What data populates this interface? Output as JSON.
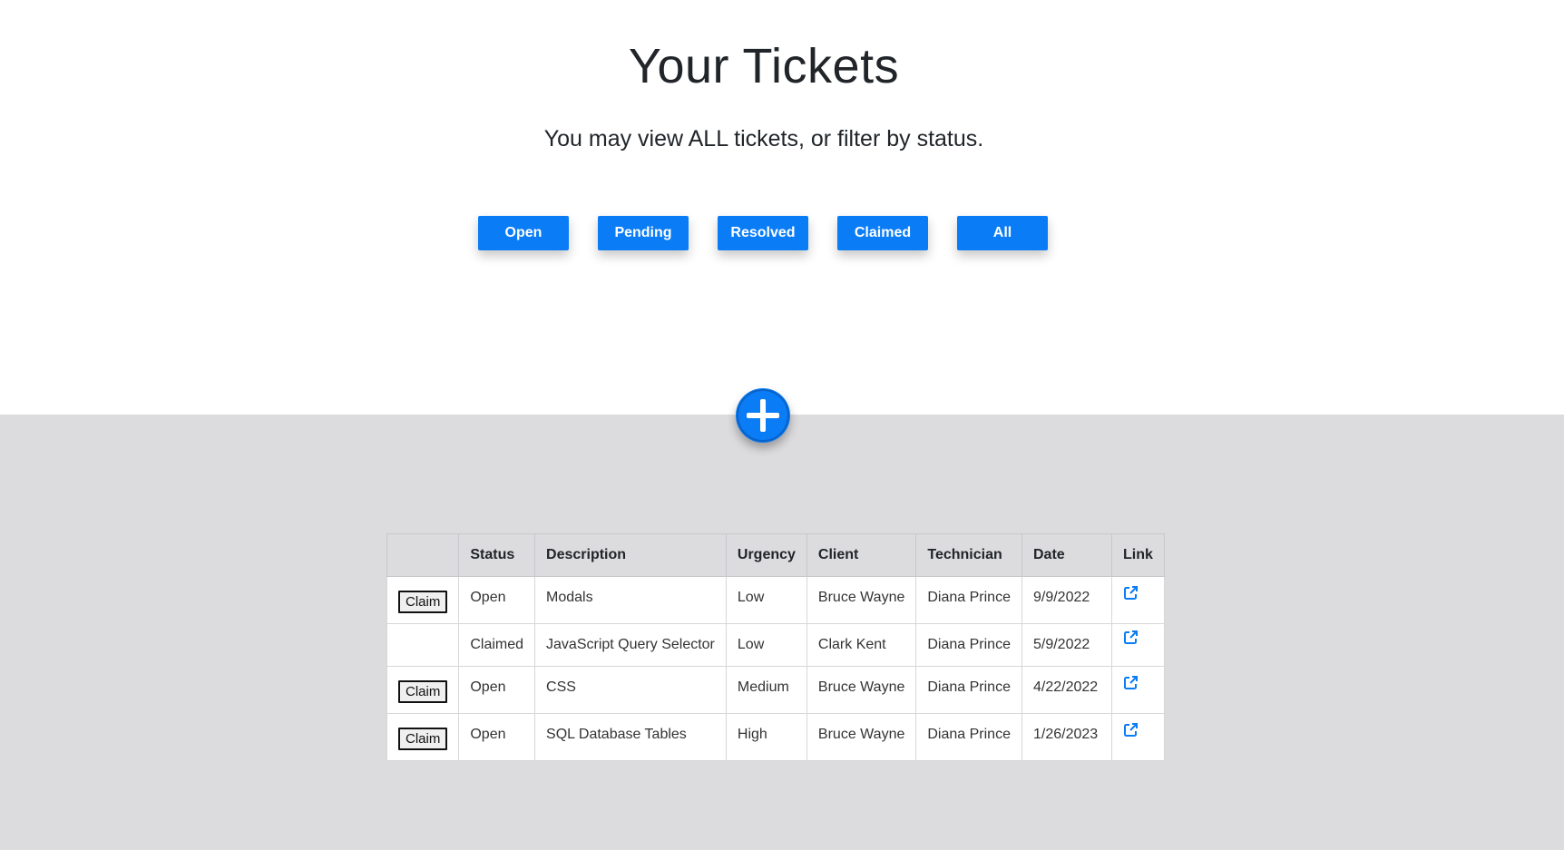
{
  "header": {
    "title": "Your Tickets",
    "subtitle": "You may view ALL tickets, or filter by status."
  },
  "filters": [
    "Open",
    "Pending",
    "Resolved",
    "Claimed",
    "All"
  ],
  "add_button_icon": "plus-circle-icon",
  "table": {
    "columns": [
      "",
      "Status",
      "Description",
      "Urgency",
      "Client",
      "Technician",
      "Date",
      "Link"
    ],
    "claim_label": "Claim",
    "rows": [
      {
        "claim": "Claim",
        "status": "Open",
        "description": "Modals",
        "urgency": "Low",
        "client": "Bruce Wayne",
        "technician": "Diana Prince",
        "date": "9/9/2022",
        "link_icon": "external-link-icon"
      },
      {
        "claim": "",
        "status": "Claimed",
        "description": "JavaScript Query Selector",
        "urgency": "Low",
        "client": "Clark Kent",
        "technician": "Diana Prince",
        "date": "5/9/2022",
        "link_icon": "external-link-icon"
      },
      {
        "claim": "Claim",
        "status": "Open",
        "description": "CSS",
        "urgency": "Medium",
        "client": "Bruce Wayne",
        "technician": "Diana Prince",
        "date": "4/22/2022",
        "link_icon": "external-link-icon"
      },
      {
        "claim": "Claim",
        "status": "Open",
        "description": "SQL Database Tables",
        "urgency": "High",
        "client": "Bruce Wayne",
        "technician": "Diana Prince",
        "date": "1/26/2023",
        "link_icon": "external-link-icon"
      }
    ]
  },
  "colors": {
    "accent": "#0a7cf5",
    "bottom_background": "#dcdcde"
  }
}
